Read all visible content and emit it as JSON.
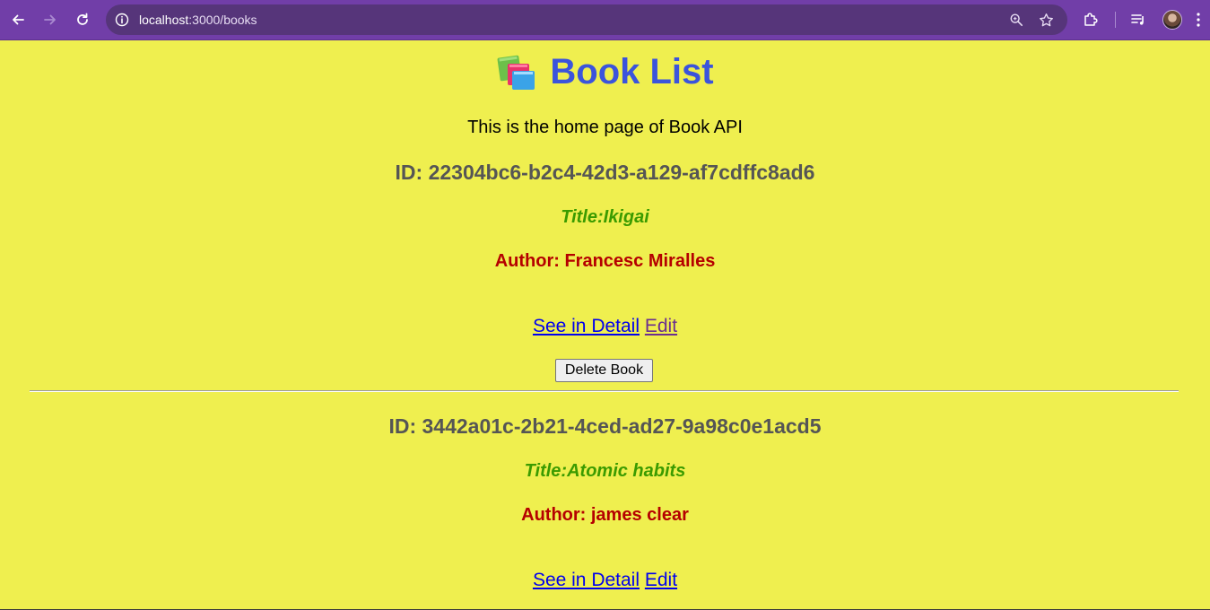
{
  "browser": {
    "url_host": "localhost",
    "url_path": ":3000/books",
    "icons": [
      "back-arrow-icon",
      "forward-arrow-icon",
      "reload-icon",
      "site-info-icon",
      "zoom-icon",
      "star-icon",
      "extensions-icon",
      "media-icon",
      "menu-dots-icon"
    ]
  },
  "page": {
    "title": "Book List",
    "subtitle": "This is the home page of Book API",
    "books": [
      {
        "id": "ID: 22304bc6-b2c4-42d3-a129-af7cdffc8ad6",
        "title": "Title:Ikigai",
        "author": "Author: Francesc Miralles",
        "detail_link": "See in Detail",
        "edit_link": "Edit",
        "delete_label": "Delete Book"
      },
      {
        "id": "ID: 3442a01c-2b21-4ced-ad27-9a98c0e1acd5",
        "title": "Title:Atomic habits",
        "author": "Author: james clear",
        "detail_link": "See in Detail",
        "edit_link": "Edit"
      }
    ]
  },
  "colors": {
    "page_background": "#efef4f",
    "heading": "#3b54dc",
    "id_text": "#555555",
    "title_text": "#3b9b00",
    "author_text": "#b50000",
    "browser_frame": "#713ea8"
  }
}
